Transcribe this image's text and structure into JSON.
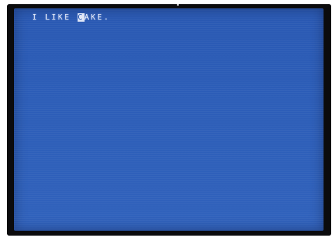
{
  "screen": {
    "text_before_cursor": "I LIKE ",
    "cursor_char": "C",
    "text_after_cursor": "AKE."
  },
  "colors": {
    "screen_blue": "#2d5eb8",
    "text": "#dfe6f7",
    "bezel": "#0b0b0d"
  }
}
